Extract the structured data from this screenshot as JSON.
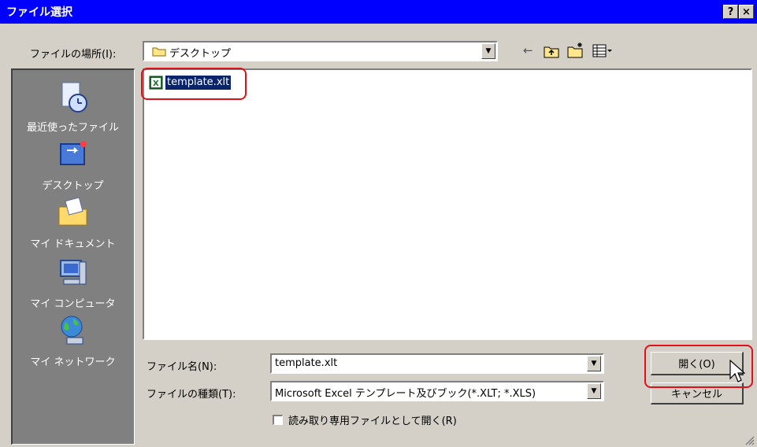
{
  "window": {
    "title": "ファイル選択",
    "help_button": "?",
    "close_button": "×"
  },
  "look_in": {
    "label": "ファイルの場所(I):",
    "value": "デスクトップ"
  },
  "toolbar": {
    "back_arrow": "←"
  },
  "places": [
    {
      "id": "recent",
      "label": "最近使ったファイル"
    },
    {
      "id": "desktop",
      "label": "デスクトップ"
    },
    {
      "id": "mydocs",
      "label": "マイ ドキュメント"
    },
    {
      "id": "mycomputer",
      "label": "マイ コンピュータ"
    },
    {
      "id": "network",
      "label": "マイ ネットワーク"
    }
  ],
  "files": [
    {
      "name": "template.xlt",
      "selected": true
    }
  ],
  "filename": {
    "label": "ファイル名(N):",
    "value": "template.xlt"
  },
  "filetype": {
    "label": "ファイルの種類(T):",
    "value": "Microsoft Excel テンプレート及びブック(*.XLT; *.XLS)"
  },
  "readonly": {
    "label": "読み取り専用ファイルとして開く(R)",
    "checked": false
  },
  "buttons": {
    "open": "開く(O)",
    "cancel": "キャンセル"
  },
  "colors": {
    "title_bar": "#0000ff",
    "highlight": "#e0101a",
    "selection": "#0a246a"
  }
}
